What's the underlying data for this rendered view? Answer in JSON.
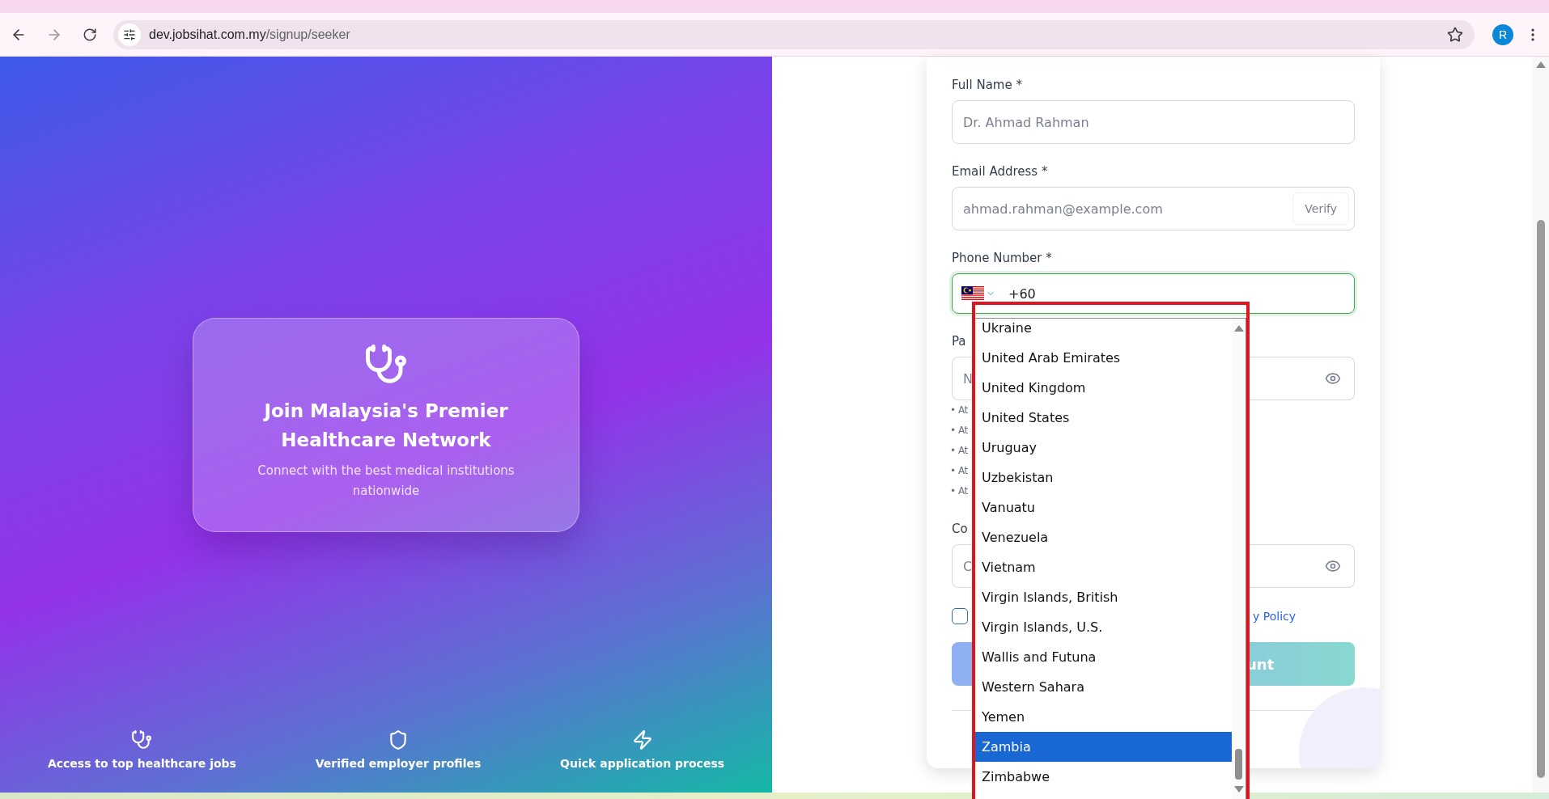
{
  "browser": {
    "url_host": "dev.jobsihat.com.my",
    "url_path": "/signup/seeker",
    "avatar_letter": "R",
    "forward_disabled": true
  },
  "hero": {
    "title": "Join Malaysia's Premier Healthcare Network",
    "subtitle": "Connect with the best medical institutions nationwide"
  },
  "features": [
    {
      "kind": "stethoscope",
      "label": "Access to top healthcare jobs"
    },
    {
      "kind": "shield",
      "label": "Verified employer profiles"
    },
    {
      "kind": "bolt",
      "label": "Quick application process"
    }
  ],
  "form": {
    "full_name": {
      "label": "Full Name *",
      "placeholder": "Dr. Ahmad Rahman"
    },
    "email": {
      "label": "Email Address *",
      "placeholder": "ahmad.rahman@example.com",
      "button": "Verify"
    },
    "phone": {
      "label": "Phone Number *",
      "value": "+60"
    },
    "password": {
      "label": "Pa",
      "placeholder": "N"
    },
    "password_rules": [
      "• At",
      "• At",
      "• At",
      "• At",
      "• At"
    ],
    "confirm": {
      "label": "Co",
      "placeholder": "C"
    },
    "terms": {
      "checked": false,
      "link": "y Policy"
    },
    "submit": "unt"
  },
  "country_dropdown": {
    "items": [
      {
        "label": "Ukraine",
        "selected": false
      },
      {
        "label": "United Arab Emirates",
        "selected": false
      },
      {
        "label": "United Kingdom",
        "selected": false
      },
      {
        "label": "United States",
        "selected": false
      },
      {
        "label": "Uruguay",
        "selected": false
      },
      {
        "label": "Uzbekistan",
        "selected": false
      },
      {
        "label": "Vanuatu",
        "selected": false
      },
      {
        "label": "Venezuela",
        "selected": false
      },
      {
        "label": "Vietnam",
        "selected": false
      },
      {
        "label": "Virgin Islands, British",
        "selected": false
      },
      {
        "label": "Virgin Islands, U.S.",
        "selected": false
      },
      {
        "label": "Wallis and Futuna",
        "selected": false
      },
      {
        "label": "Western Sahara",
        "selected": false
      },
      {
        "label": "Yemen",
        "selected": false
      },
      {
        "label": "Zambia",
        "selected": true
      },
      {
        "label": "Zimbabwe",
        "selected": false
      }
    ]
  }
}
